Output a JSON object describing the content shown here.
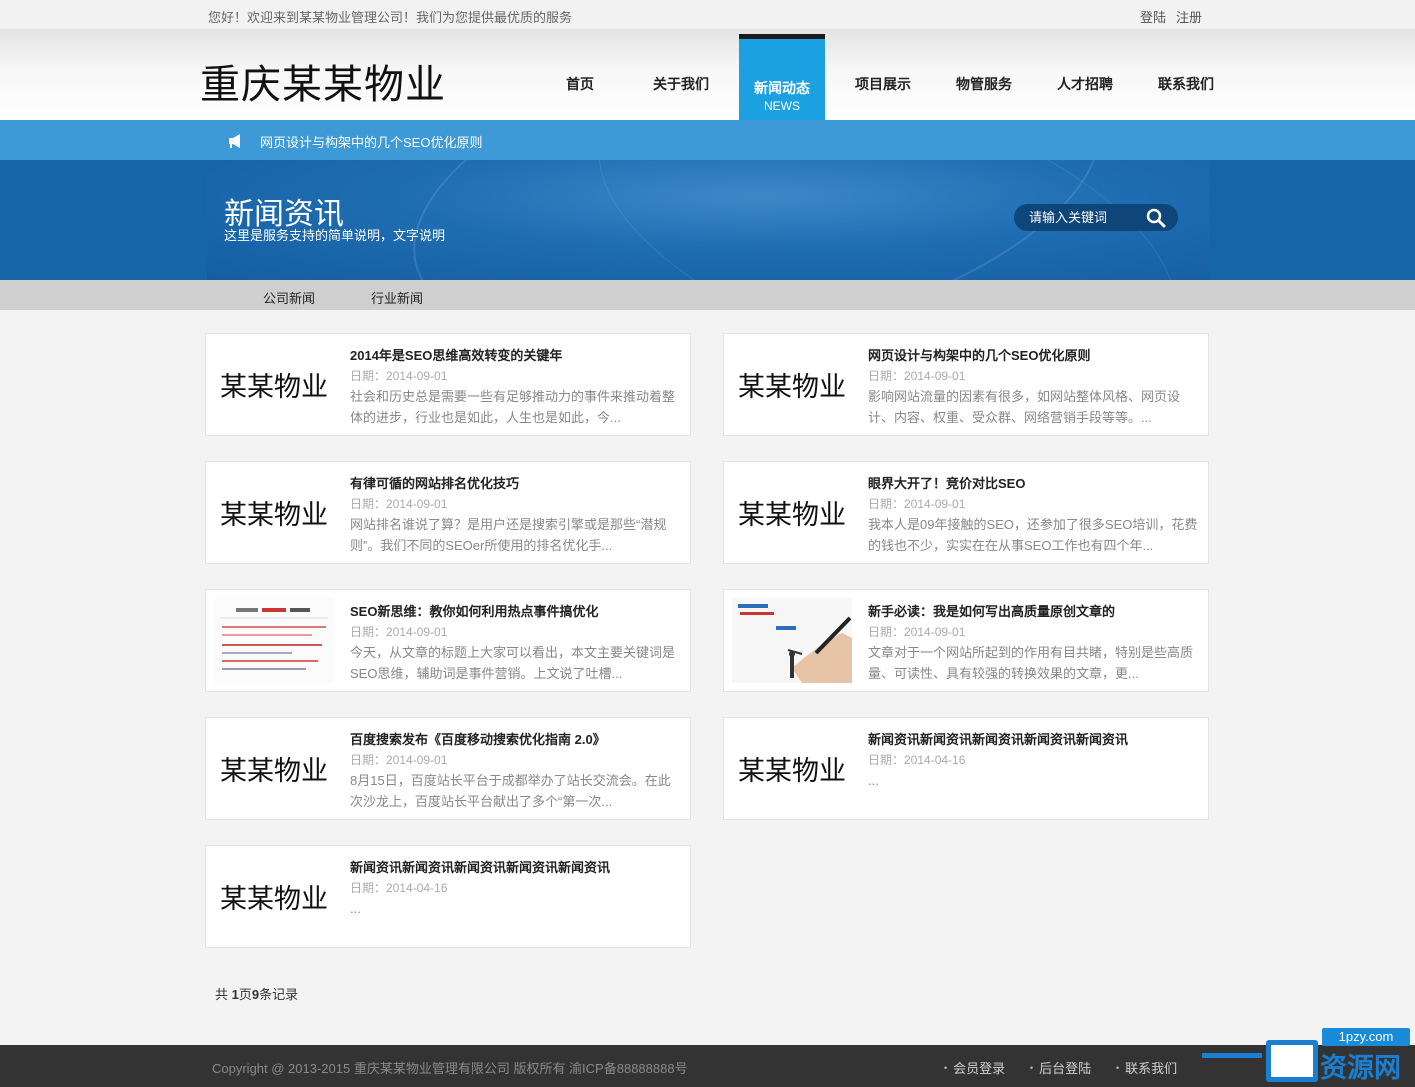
{
  "topbar": {
    "welcome": "您好！欢迎来到某某物业管理公司！我们为您提供最优质的服务",
    "login": "登陆",
    "register": "注册"
  },
  "header": {
    "logo": "重庆某某物业",
    "nav": [
      {
        "label": "首页"
      },
      {
        "label": "关于我们"
      },
      {
        "label": "新闻动态",
        "sub": "NEWS",
        "active": true
      },
      {
        "label": "项目展示"
      },
      {
        "label": "物管服务"
      },
      {
        "label": "人才招聘"
      },
      {
        "label": "联系我们"
      }
    ],
    "active_color": "#1ba0e1"
  },
  "announcement": {
    "icon": "speaker-icon",
    "text": "网页设计与构架中的几个SEO优化原则"
  },
  "banner": {
    "title": "新闻资讯",
    "description": "这里是服务支持的简单说明，文字说明",
    "search_placeholder": "请输入关键词",
    "search_icon": "search-icon"
  },
  "subnav": [
    "公司新闻",
    "行业新闻"
  ],
  "placeholder_thumb_text": "某某物业",
  "news": [
    {
      "title": "2014年是SEO思维高效转变的关键年",
      "date": "日期：2014-09-01",
      "desc": "社会和历史总是需要一些有足够推动力的事件来推动着整体的进步，行业也是如此，人生也是如此，今..."
    },
    {
      "title": "网页设计与构架中的几个SEO优化原则",
      "date": "日期：2014-09-01",
      "desc": "影响网站流量的因素有很多，如网站整体风格、网页设计、内容、权重、受众群、网络营销手段等等。..."
    },
    {
      "title": "有律可循的网站排名优化技巧",
      "date": "日期：2014-09-01",
      "desc": "网站排名谁说了算？是用户还是搜索引擎或是那些“潜规则”。我们不同的SEOer所使用的排名优化手..."
    },
    {
      "title": "眼界大开了！竞价对比SEO",
      "date": "日期：2014-09-01",
      "desc": "我本人是09年接触的SEO，还参加了很多SEO培训，花费的钱也不少，实实在在从事SEO工作也有四个年..."
    },
    {
      "title": "SEO新思维：教你如何利用热点事件搞优化",
      "date": "日期：2014-09-01",
      "desc": "今天，从文章的标题上大家可以看出，本文主要关键词是SEO思维，辅助词是事件营销。上文说了吐槽..."
    },
    {
      "title": "新手必读：我是如何写出高质量原创文章的",
      "date": "日期：2014-09-01",
      "desc": "文章对于一个网站所起到的作用有目共睹，特别是些高质量、可读性、具有较强的转换效果的文章，更..."
    },
    {
      "title": "百度搜索发布《百度移动搜索优化指南 2.0》",
      "date": "日期：2014-09-01",
      "desc": "8月15日，百度站长平台于成都举办了站长交流会。在此次沙龙上，百度站长平台献出了多个“第一次..."
    },
    {
      "title": "新闻资讯新闻资讯新闻资讯新闻资讯新闻资讯",
      "date": "日期：2014-04-16",
      "desc": "..."
    },
    {
      "title": "新闻资讯新闻资讯新闻资讯新闻资讯新闻资讯",
      "date": "日期：2014-04-16",
      "desc": "..."
    }
  ],
  "pagination": {
    "prefix": "共 ",
    "pages": "1",
    "middle": "页",
    "records": "9",
    "suffix": "条记录"
  },
  "footer": {
    "copyright": "Copyright @ 2013-2015 重庆某某物业管理有限公司 版权所有 渝ICP备88888888号",
    "links": [
      "会员登录",
      "后台登陆",
      "联系我们"
    ]
  },
  "watermark": {
    "url": "1pzy.com",
    "brand": "资源网"
  }
}
